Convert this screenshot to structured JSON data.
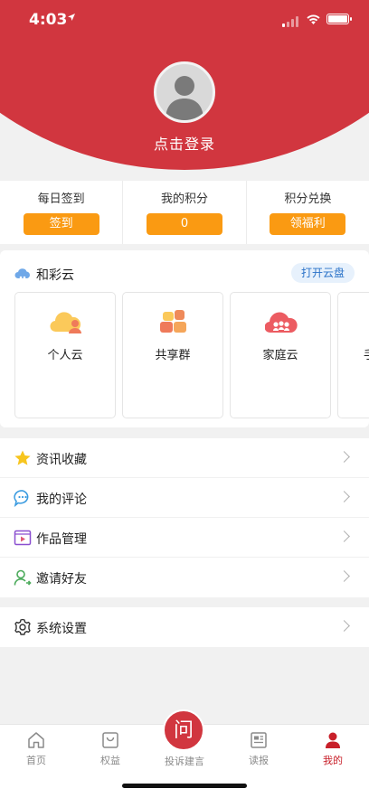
{
  "status_bar": {
    "time": "4:03"
  },
  "profile": {
    "login_text": "点击登录"
  },
  "stats": [
    {
      "label": "每日签到",
      "button": "签到"
    },
    {
      "label": "我的积分",
      "button": "0"
    },
    {
      "label": "积分兑换",
      "button": "领福利"
    }
  ],
  "cloud": {
    "title": "和彩云",
    "open_button": "打开云盘",
    "cards": [
      {
        "label": "个人云",
        "icon": "personal-cloud-icon"
      },
      {
        "label": "共享群",
        "icon": "share-group-icon"
      },
      {
        "label": "家庭云",
        "icon": "family-cloud-icon"
      },
      {
        "label": "手",
        "icon": "partial-card-icon"
      }
    ]
  },
  "menu": [
    {
      "label": "资讯收藏",
      "icon": "star-icon"
    },
    {
      "label": "我的评论",
      "icon": "comment-icon"
    },
    {
      "label": "作品管理",
      "icon": "video-icon"
    },
    {
      "label": "邀请好友",
      "icon": "invite-user-icon"
    }
  ],
  "settings": {
    "label": "系统设置",
    "icon": "gear-icon"
  },
  "tabbar": {
    "home": "首页",
    "benefits": "权益",
    "complaint": "投诉建言",
    "complaint_glyph": "问",
    "news": "读报",
    "mine": "我的"
  },
  "colors": {
    "brand_red": "#d1363f",
    "orange": "#fa9a12",
    "active_tab": "#c8202a"
  }
}
